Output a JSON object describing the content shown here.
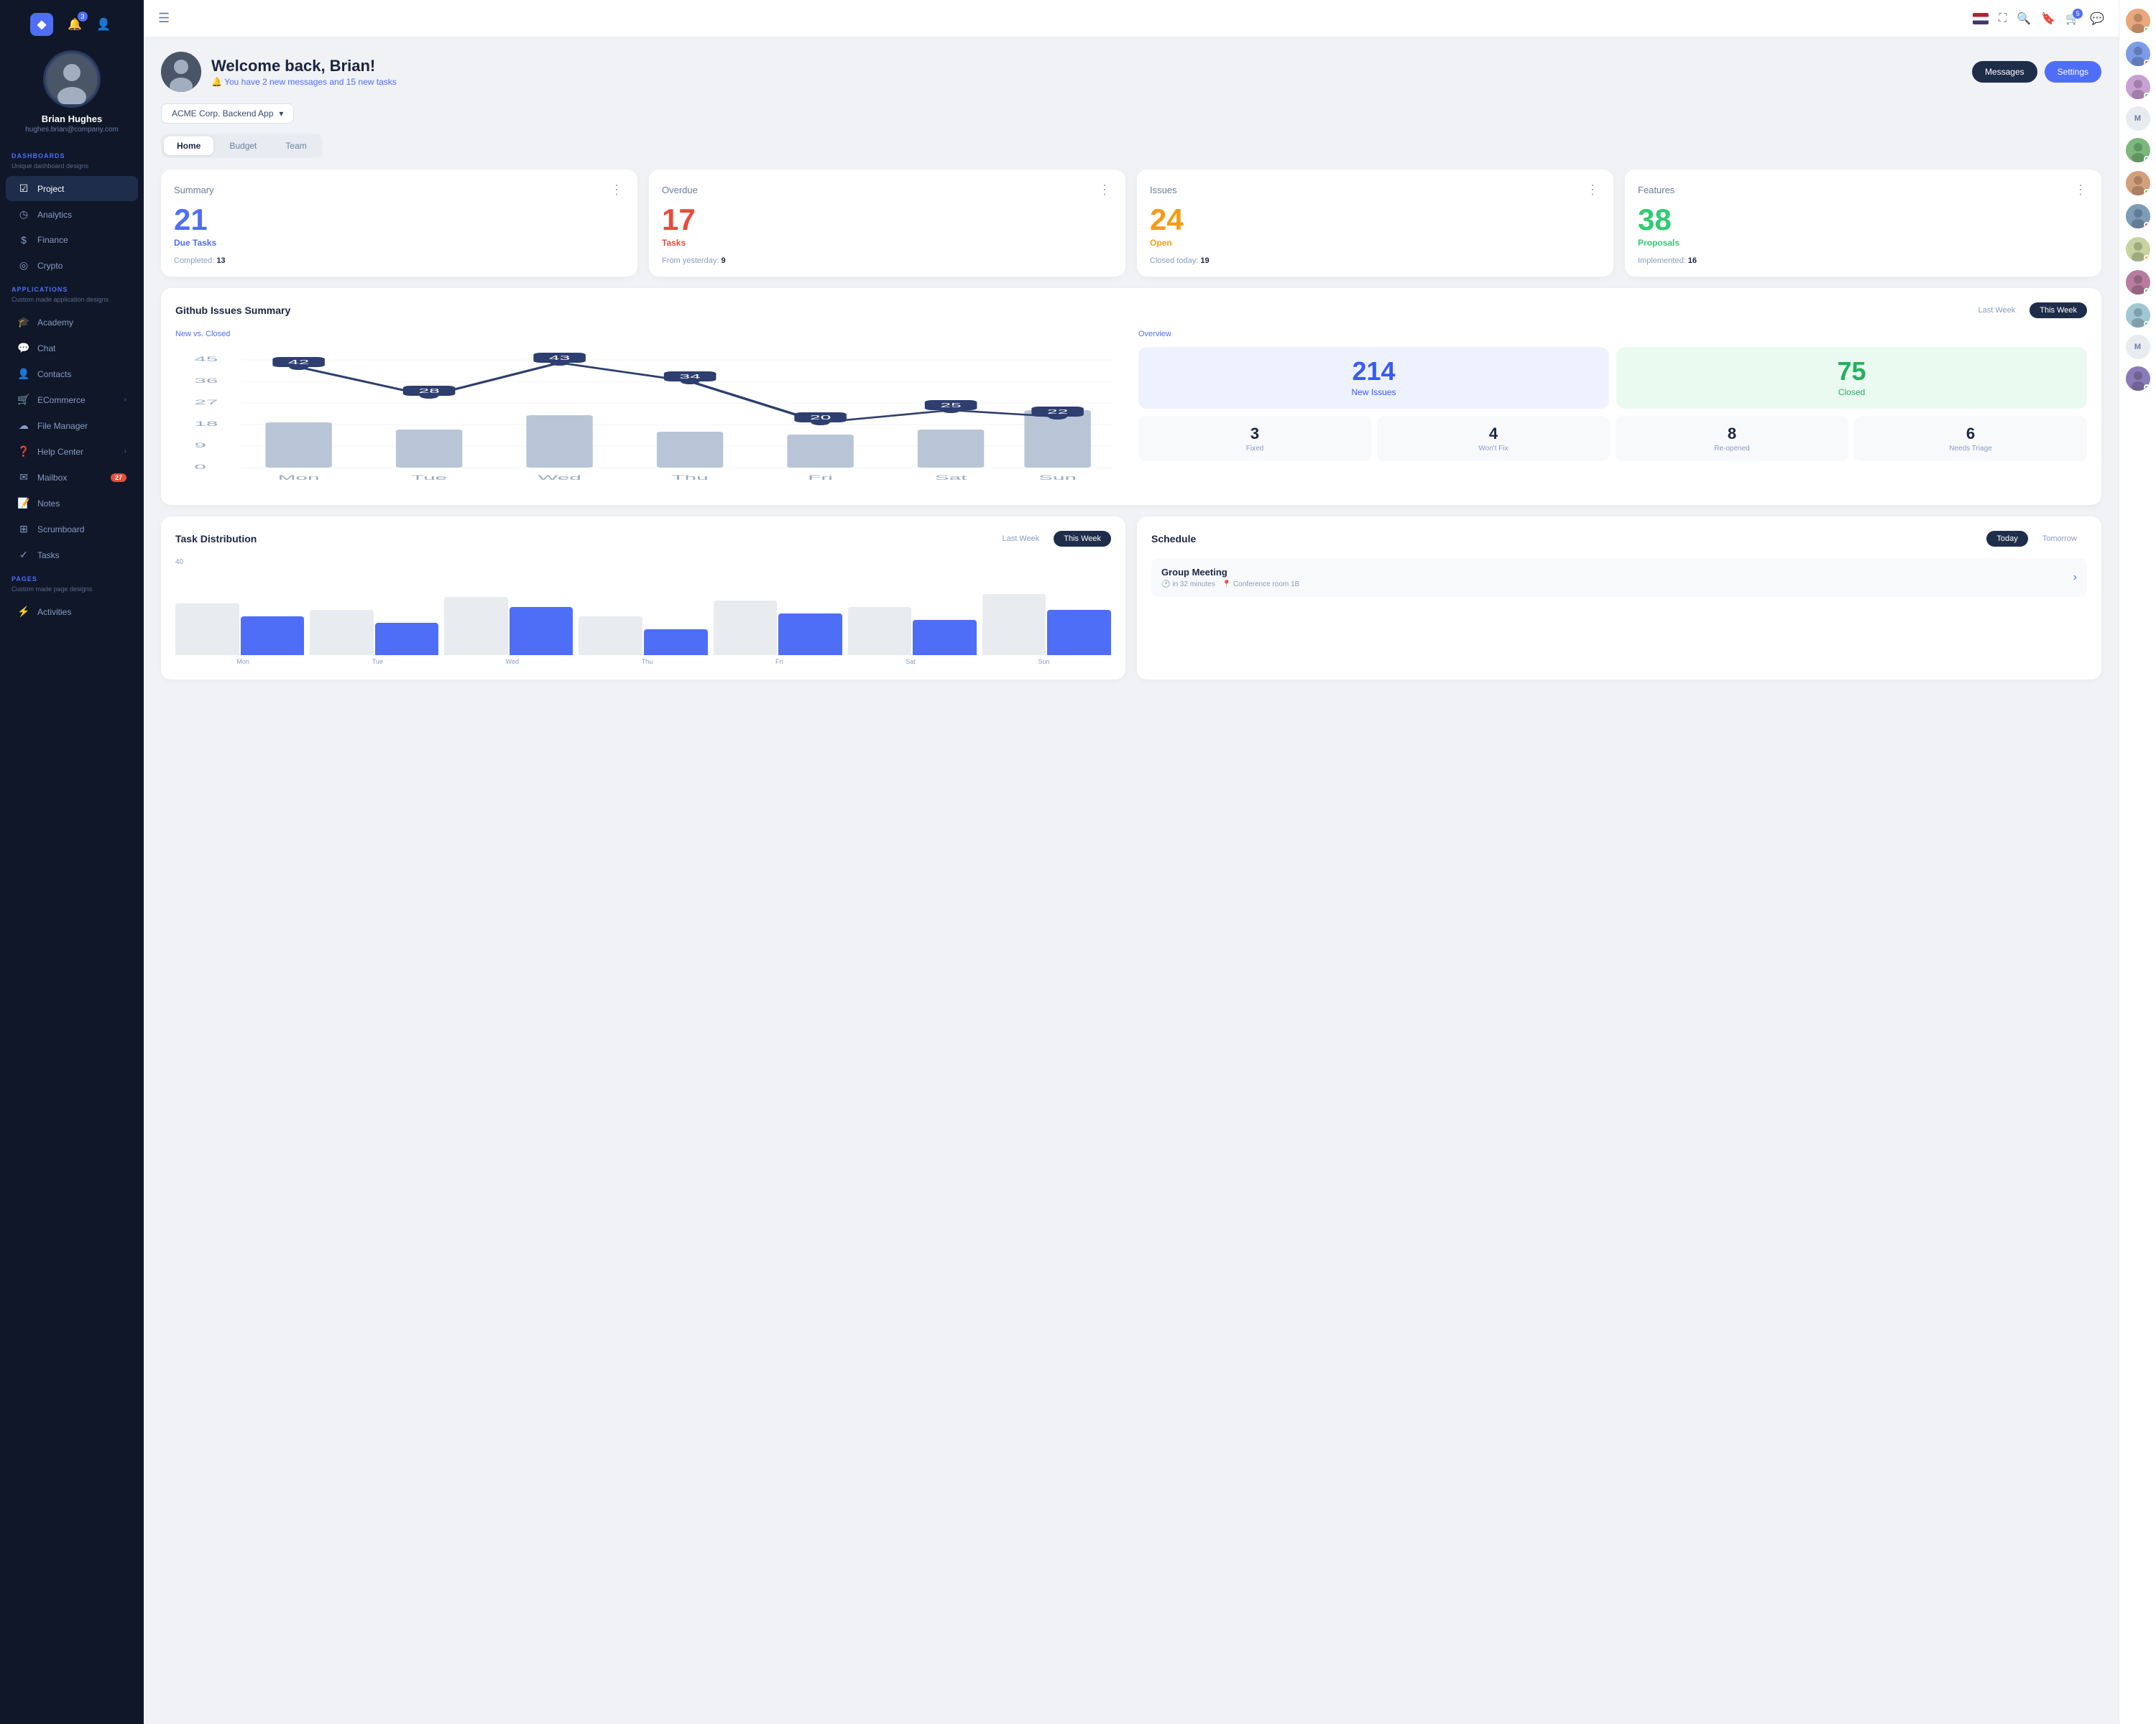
{
  "sidebar": {
    "logo": "◆",
    "notification_badge": "3",
    "user": {
      "name": "Brian Hughes",
      "email": "hughes.brian@company.com"
    },
    "sections": [
      {
        "label": "DASHBOARDS",
        "sub": "Unique dashboard designs",
        "items": [
          {
            "id": "project",
            "icon": "☑",
            "label": "Project",
            "active": true
          },
          {
            "id": "analytics",
            "icon": "◷",
            "label": "Analytics"
          },
          {
            "id": "finance",
            "icon": "$",
            "label": "Finance"
          },
          {
            "id": "crypto",
            "icon": "◎",
            "label": "Crypto"
          }
        ]
      },
      {
        "label": "APPLICATIONS",
        "sub": "Custom made application designs",
        "items": [
          {
            "id": "academy",
            "icon": "🎓",
            "label": "Academy"
          },
          {
            "id": "chat",
            "icon": "💬",
            "label": "Chat"
          },
          {
            "id": "contacts",
            "icon": "👤",
            "label": "Contacts"
          },
          {
            "id": "ecommerce",
            "icon": "🛒",
            "label": "ECommerce",
            "arrow": true
          },
          {
            "id": "filemanager",
            "icon": "☁",
            "label": "File Manager"
          },
          {
            "id": "helpcenter",
            "icon": "❓",
            "label": "Help Center",
            "arrow": true
          },
          {
            "id": "mailbox",
            "icon": "✉",
            "label": "Mailbox",
            "badge": "27"
          },
          {
            "id": "notes",
            "icon": "📝",
            "label": "Notes"
          },
          {
            "id": "scrumboard",
            "icon": "⊞",
            "label": "Scrumboard"
          },
          {
            "id": "tasks",
            "icon": "✓",
            "label": "Tasks"
          }
        ]
      },
      {
        "label": "PAGES",
        "sub": "Custom made page designs",
        "items": [
          {
            "id": "activities",
            "icon": "⚡",
            "label": "Activities"
          }
        ]
      }
    ]
  },
  "header": {
    "messages_badge": "5"
  },
  "welcome": {
    "title": "Welcome back, Brian!",
    "subtitle": "You have 2 new messages and 15 new tasks",
    "btn_messages": "Messages",
    "btn_settings": "Settings"
  },
  "project_selector": {
    "label": "ACME Corp. Backend App"
  },
  "tabs": [
    {
      "id": "home",
      "label": "Home",
      "active": true
    },
    {
      "id": "budget",
      "label": "Budget"
    },
    {
      "id": "team",
      "label": "Team"
    }
  ],
  "stats": [
    {
      "title": "Summary",
      "number": "21",
      "color": "blue",
      "label": "Due Tasks",
      "secondary_key": "Completed:",
      "secondary_val": "13"
    },
    {
      "title": "Overdue",
      "number": "17",
      "color": "red",
      "label": "Tasks",
      "secondary_key": "From yesterday:",
      "secondary_val": "9"
    },
    {
      "title": "Issues",
      "number": "24",
      "color": "orange",
      "label": "Open",
      "secondary_key": "Closed today:",
      "secondary_val": "19"
    },
    {
      "title": "Features",
      "number": "38",
      "color": "green",
      "label": "Proposals",
      "secondary_key": "Implemented:",
      "secondary_val": "16"
    }
  ],
  "github": {
    "title": "Github Issues Summary",
    "week_last": "Last Week",
    "week_this": "This Week",
    "chart_subtitle": "New vs. Closed",
    "overview_subtitle": "Overview",
    "chart_data": {
      "labels": [
        "Mon",
        "Tue",
        "Wed",
        "Thu",
        "Fri",
        "Sat",
        "Sun"
      ],
      "line_values": [
        42,
        28,
        43,
        34,
        20,
        25,
        22
      ],
      "bar_heights": [
        65,
        55,
        75,
        50,
        45,
        55,
        80
      ]
    },
    "new_issues": "214",
    "new_issues_label": "New Issues",
    "closed": "75",
    "closed_label": "Closed",
    "mini_stats": [
      {
        "num": "3",
        "label": "Fixed"
      },
      {
        "num": "4",
        "label": "Won't Fix"
      },
      {
        "num": "8",
        "label": "Re-opened"
      },
      {
        "num": "6",
        "label": "Needs Triage"
      }
    ]
  },
  "task_dist": {
    "title": "Task Distribution",
    "week_last": "Last Week",
    "week_this": "This Week",
    "bar_label": "40",
    "x_labels": [
      "Mon",
      "Tue",
      "Wed",
      "Thu",
      "Fri",
      "Sat",
      "Sun"
    ],
    "bars": [
      {
        "val1": 60,
        "val2": 80
      },
      {
        "val1": 50,
        "val2": 70
      },
      {
        "val1": 75,
        "val2": 90
      },
      {
        "val1": 40,
        "val2": 60
      },
      {
        "val1": 65,
        "val2": 85
      },
      {
        "val1": 55,
        "val2": 75
      },
      {
        "val1": 70,
        "val2": 95
      }
    ]
  },
  "schedule": {
    "title": "Schedule",
    "btn_today": "Today",
    "btn_tomorrow": "Tomorrow",
    "items": [
      {
        "title": "Group Meeting",
        "time": "in 32 minutes",
        "location": "Conference room 1B"
      }
    ]
  },
  "right_sidebar": {
    "avatars": [
      {
        "color": "#e8a87c",
        "dot": "green",
        "initials": ""
      },
      {
        "color": "#7c9ce8",
        "dot": "red",
        "initials": ""
      },
      {
        "color": "#c8a0d4",
        "dot": "green",
        "initials": ""
      },
      {
        "color": "#e0e0e0",
        "dot": "",
        "initials": "M"
      },
      {
        "color": "#7cb87c",
        "dot": "green",
        "initials": ""
      },
      {
        "color": "#d4a07c",
        "dot": "green",
        "initials": ""
      },
      {
        "color": "#7c9cb8",
        "dot": "red",
        "initials": ""
      },
      {
        "color": "#c8d4a0",
        "dot": "orange",
        "initials": ""
      },
      {
        "color": "#b87ca0",
        "dot": "green",
        "initials": ""
      },
      {
        "color": "#a0c8d4",
        "dot": "green",
        "initials": ""
      },
      {
        "color": "#e0e0e0",
        "dot": "",
        "initials": "M"
      },
      {
        "color": "#8a7cb8",
        "dot": "green",
        "initials": ""
      }
    ]
  }
}
